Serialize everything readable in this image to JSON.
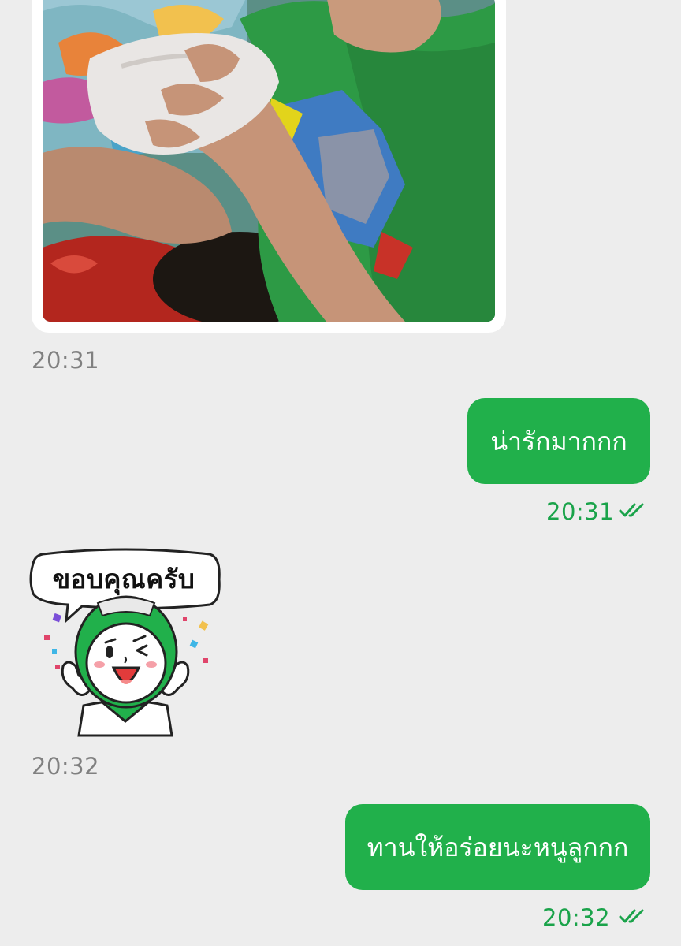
{
  "messages": [
    {
      "type": "image",
      "direction": "incoming",
      "time": "20:31"
    },
    {
      "type": "text",
      "direction": "outgoing",
      "text": "น่ารักมากกก",
      "time": "20:31",
      "status": "read"
    },
    {
      "type": "sticker",
      "direction": "incoming",
      "sticker_text": "ขอบคุณครับ",
      "time": "20:32"
    },
    {
      "type": "text",
      "direction": "outgoing",
      "text": "ทานให้อร่อยนะหนูลูกกก",
      "time": "20:32",
      "status": "read"
    }
  ],
  "colors": {
    "background": "#ededed",
    "outgoing_bubble": "#21b04b",
    "outgoing_time": "#1aa34a",
    "incoming_time": "#808080"
  },
  "icons": {
    "read_receipt": "double-check-icon"
  }
}
